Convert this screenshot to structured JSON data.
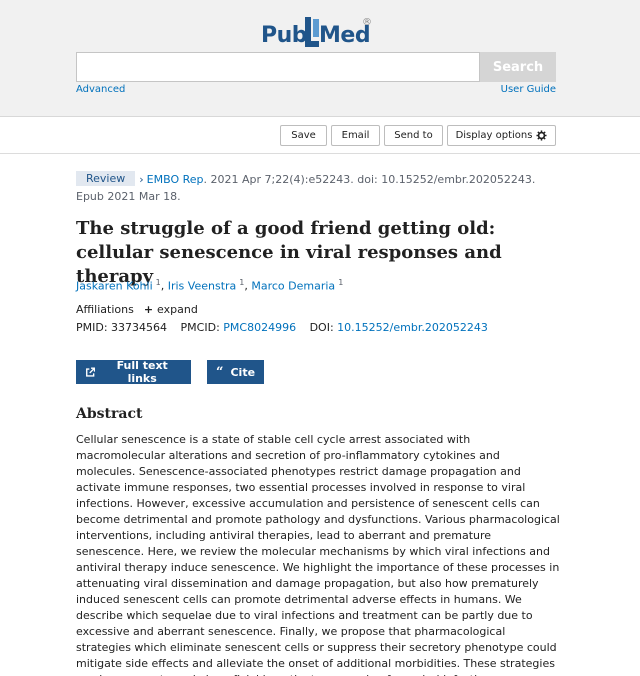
{
  "header": {
    "logo_pub": "Pub",
    "logo_med": "Med",
    "logo_reg": "®",
    "search_placeholder": "",
    "search_label": "Search",
    "advanced_label": "Advanced",
    "user_guide_label": "User Guide",
    "brand_color": "#20558a"
  },
  "actions": {
    "save": "Save",
    "email": "Email",
    "send_to": "Send to",
    "display_options": "Display options"
  },
  "article": {
    "badge": "Review",
    "journal": "EMBO Rep",
    "citation": ". 2021 Apr 7;22(4):e52243. doi: 10.15252/embr.202052243.",
    "epub": "Epub 2021 Mar 18.",
    "title": "The struggle of a good friend getting old: cellular senescence in viral responses and therapy",
    "authors": [
      {
        "name": "Jaskaren Kohli",
        "aff": "1"
      },
      {
        "name": "Iris Veenstra",
        "aff": "1"
      },
      {
        "name": "Marco Demaria",
        "aff": "1"
      }
    ],
    "affiliations_label": "Affiliations",
    "expand_label": "expand",
    "pmid_label": "PMID:",
    "pmid": "33734564",
    "pmcid_label": "PMCID:",
    "pmcid": "PMC8024996",
    "doi_label": "DOI:",
    "doi": "10.15252/embr.202052243",
    "full_text_label": "Full text links",
    "cite_label": "Cite",
    "abstract_heading": "Abstract",
    "abstract": "Cellular senescence is a state of stable cell cycle arrest associated with macromolecular alterations and secretion of pro-inflammatory cytokines and molecules. Senescence-associated phenotypes restrict damage propagation and activate immune responses, two essential processes involved in response to viral infections. However, excessive accumulation and persistence of senescent cells can become detrimental and promote pathology and dysfunctions. Various pharmacological interventions, including antiviral therapies, lead to aberrant and premature senescence. Here, we review the molecular mechanisms by which viral infections and antiviral therapy induce senescence. We highlight the importance of these processes in attenuating viral dissemination and damage propagation, but also how prematurely induced senescent cells can promote detrimental adverse effects in humans. We describe which sequelae due to viral infections and treatment can be partly due to excessive and aberrant senescence. Finally, we propose that pharmacological strategies which eliminate senescent cells or suppress their secretory phenotype could mitigate side effects and alleviate the onset of additional morbidities. These strategies can become extremely beneficial in patients recovering from viral infections or undergoing antiviral therapy."
  }
}
